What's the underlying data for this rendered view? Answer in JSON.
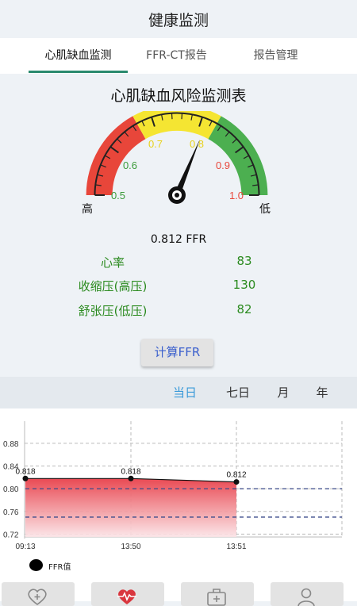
{
  "header": {
    "title": "健康监测"
  },
  "tabs": [
    {
      "label": "心肌缺血监测",
      "active": true
    },
    {
      "label": "FFR-CT报告",
      "active": false
    },
    {
      "label": "报告管理",
      "active": false
    }
  ],
  "panel": {
    "title": "心肌缺血风险监测表"
  },
  "gauge": {
    "ticks": [
      "0.5",
      "0.6",
      "0.7",
      "0.8",
      "0.9",
      "1.0"
    ],
    "high_label": "高",
    "low_label": "低",
    "reading": 0.812,
    "zone_colors": {
      "low_ffr": "#e8463a",
      "mid": "#f5e532",
      "high_ffr": "#4caf50"
    }
  },
  "ffr_display": "0.812 FFR",
  "vitals": [
    {
      "label": "心率",
      "value": "83"
    },
    {
      "label": "收缩压(高压)",
      "value": "130"
    },
    {
      "label": "舒张压(低压)",
      "value": "82"
    }
  ],
  "calc_button": "计算FFR",
  "range_tabs": [
    {
      "label": "当日",
      "active": true
    },
    {
      "label": "七日",
      "active": false
    },
    {
      "label": "月",
      "active": false
    },
    {
      "label": "年",
      "active": false
    }
  ],
  "chart_data": {
    "type": "area",
    "x": [
      "09:13",
      "13:50",
      "13:51"
    ],
    "series": [
      {
        "name": "FFR值",
        "values": [
          0.818,
          0.818,
          0.812
        ]
      }
    ],
    "yticks": [
      "0.72",
      "0.76",
      "0.80",
      "0.84",
      "0.88"
    ],
    "ylim": [
      0.715,
      0.905
    ],
    "reference_lines": [
      0.8,
      0.75
    ],
    "grid": true,
    "legend": "bottom-left"
  },
  "bottom_nav": [
    {
      "icon": "heart-plus-icon"
    },
    {
      "icon": "heartbeat-icon"
    },
    {
      "icon": "medical-kit-icon"
    },
    {
      "icon": "user-icon"
    }
  ]
}
